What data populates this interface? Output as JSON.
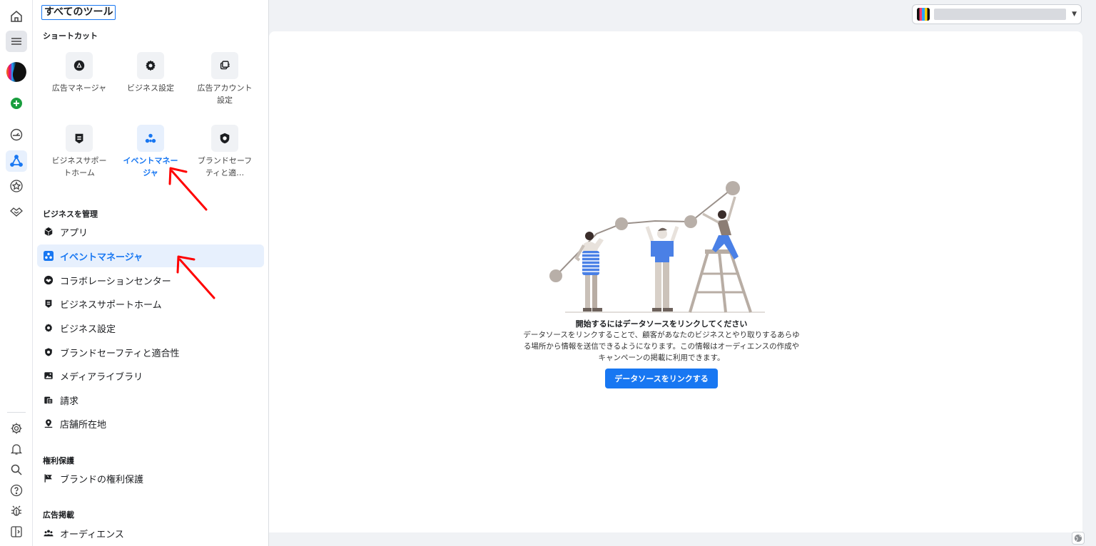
{
  "panel": {
    "title": "すべてのツール",
    "shortcuts_heading": "ショートカット",
    "shortcuts": [
      {
        "label": "広告マネージャ",
        "icon": "ads-manager-icon"
      },
      {
        "label": "ビジネス設定",
        "icon": "gear-icon"
      },
      {
        "label": "広告アカウント設定",
        "icon": "ad-account-settings-icon"
      },
      {
        "label": "ビジネスサポートホーム",
        "icon": "business-support-icon"
      },
      {
        "label": "イベントマネージャ",
        "icon": "events-manager-icon",
        "selected": true
      },
      {
        "label": "ブランドセーフティと適…",
        "icon": "shield-icon"
      }
    ],
    "manage_heading": "ビジネスを管理",
    "manage_items": [
      {
        "label": "アプリ",
        "icon": "cube-icon"
      },
      {
        "label": "イベントマネージャ",
        "icon": "events-manager-icon",
        "active": true
      },
      {
        "label": "コラボレーションセンター",
        "icon": "handshake-icon"
      },
      {
        "label": "ビジネスサポートホーム",
        "icon": "business-support-icon"
      },
      {
        "label": "ビジネス設定",
        "icon": "gear-icon"
      },
      {
        "label": "ブランドセーフティと適合性",
        "icon": "shield-icon"
      },
      {
        "label": "メディアライブラリ",
        "icon": "image-icon"
      },
      {
        "label": "請求",
        "icon": "billing-icon"
      },
      {
        "label": "店舗所在地",
        "icon": "location-pin-icon"
      }
    ],
    "rights_heading": "権利保護",
    "rights_items": [
      {
        "label": "ブランドの権利保護",
        "icon": "flag-icon"
      }
    ],
    "ads_heading": "広告掲載",
    "ads_items": [
      {
        "label": "オーディエンス",
        "icon": "people-icon"
      }
    ]
  },
  "main": {
    "empty_title": "開始するにはデータソースをリンクしてください",
    "empty_desc": "データソースをリンクすることで、顧客があなたのビジネスとやり取りするあらゆる場所から情報を送信できるようになります。この情報はオーディエンスの作成やキャンペーンの掲載に利用できます。",
    "cta_label": "データソースをリンクする"
  },
  "colors": {
    "accent": "#1877f2",
    "active_bg": "#e7f0fd",
    "annotation_arrow": "#ff0000"
  }
}
